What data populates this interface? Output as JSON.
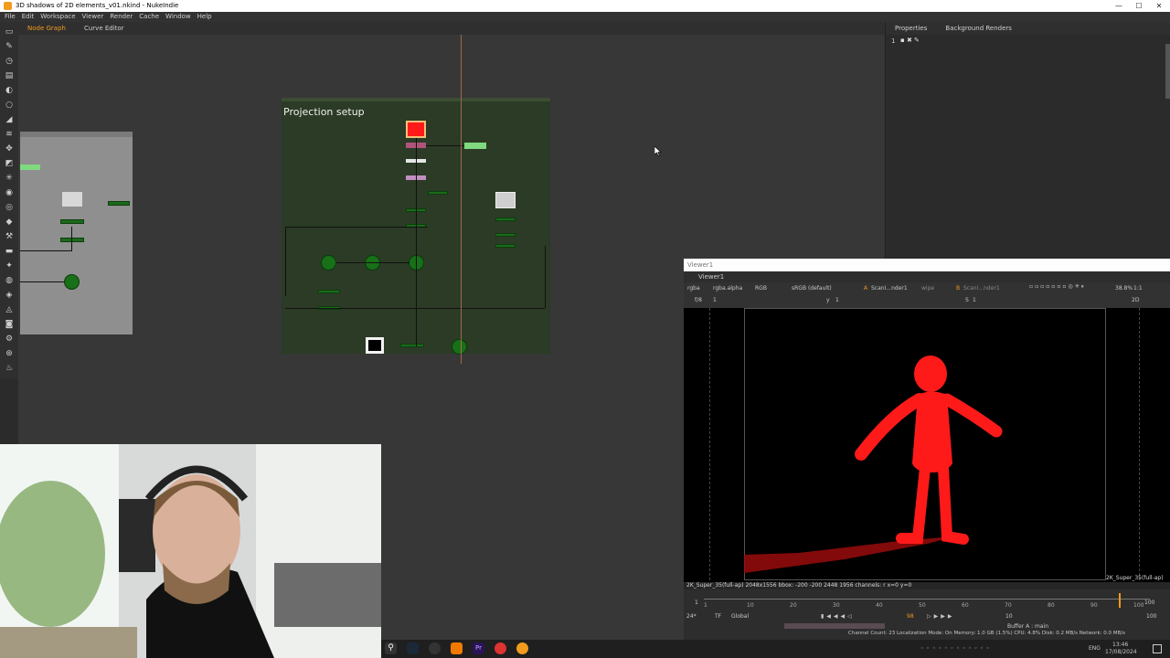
{
  "window": {
    "title": "3D shadows of 2D elements_v01.nkind - NukeIndie",
    "controls": [
      "—",
      "☐",
      "✕"
    ]
  },
  "menubar": [
    "File",
    "Edit",
    "Workspace",
    "Viewer",
    "Render",
    "Cache",
    "Window",
    "Help"
  ],
  "node_graph": {
    "tabs": [
      "Node Graph",
      "Curve Editor"
    ],
    "backdrop_title": "Projection setup"
  },
  "properties": {
    "tabs": [
      "Properties",
      "Background Renders"
    ],
    "count": "1"
  },
  "viewer": {
    "window_title": "Viewer1",
    "tab": "Viewer1",
    "channels": "rgba",
    "alpha": "rgba.alpha",
    "display": "RGB",
    "colorspace": "sRGB (default)",
    "input_a_label": "A",
    "input_a": "ScanI...nder1",
    "wipe": "wipe",
    "input_b_label": "B",
    "input_b": "ScanI...nder1",
    "zoom": "38.8%",
    "ratio": "1:1",
    "fstop": "f/8",
    "frame_field": "1",
    "y_label": "y",
    "y_value": "1",
    "s_label": "S",
    "s_value": "1",
    "view_mode": "2D",
    "format_label": "2K_Super_35(full-ap)",
    "info": "2K_Super_35(full-ap) 2048x1556  bbox: -200 -200 2448 1956 channels: r  x=0 y=0"
  },
  "timeline": {
    "ticks": [
      "1",
      "10",
      "20",
      "30",
      "40",
      "50",
      "60",
      "70",
      "80",
      "90",
      "100"
    ],
    "start": "1",
    "end": "100",
    "fps": "24*",
    "tf": "TF",
    "global": "Global",
    "current_frame": "98",
    "increment": "10",
    "buffer": "Buffer A : main",
    "status": "Channel Count: 23  Localization Mode: On  Memory: 1.0 GB (1.5%)  CPU: 4.8%  Disk: 0.2 MB/s  Network: 0.0 MB/s"
  },
  "taskbar": {
    "lang": "ENG",
    "time": "13:46",
    "date": "17/08/2024"
  },
  "colors": {
    "accent": "#f29b1d",
    "node_green": "#1a6b1a",
    "backdrop": "#2b3b25",
    "figure_red": "#ff1a1a"
  }
}
